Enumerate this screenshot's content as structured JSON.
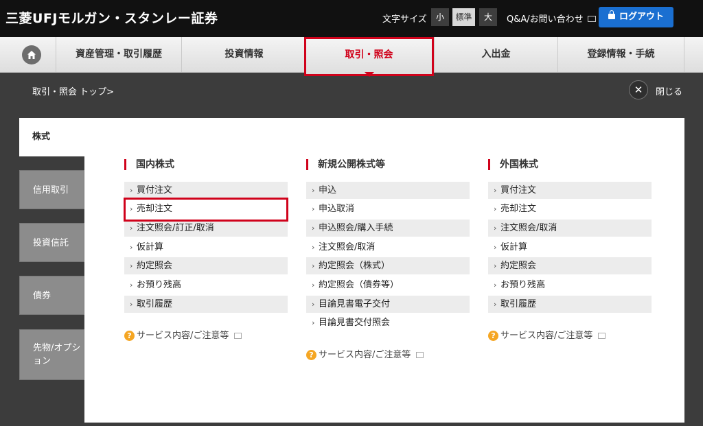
{
  "header": {
    "brand": "三菱UFJモルガン・スタンレー証券",
    "font_size_label": "文字サイズ",
    "font_small": "小",
    "font_standard": "標準",
    "font_large": "大",
    "qa_label": "Q&A/お問い合わせ",
    "logout_label": "ログアウト"
  },
  "nav": {
    "items": [
      {
        "label": "資産管理・取引履歴"
      },
      {
        "label": "投資情報"
      },
      {
        "label": "取引・照会"
      },
      {
        "label": "入出金"
      },
      {
        "label": "登録情報・手続"
      }
    ],
    "active": "取引・照会"
  },
  "breadcrumb": "取引・照会 トップ>",
  "close_label": "閉じる",
  "side_tabs": [
    {
      "label": "株式"
    },
    {
      "label": "信用取引"
    },
    {
      "label": "投資信託"
    },
    {
      "label": "債券"
    },
    {
      "label": "先物/オプション"
    }
  ],
  "columns": [
    {
      "title": "国内株式",
      "links": [
        "買付注文",
        "売却注文",
        "注文照会/訂正/取消",
        "仮計算",
        "約定照会",
        "お預り残高",
        "取引履歴"
      ],
      "service": "サービス内容/ご注意等"
    },
    {
      "title": "新規公開株式等",
      "links": [
        "申込",
        "申込取消",
        "申込照会/購入手続",
        "注文照会/取消",
        "約定照会（株式）",
        "約定照会（債券等）",
        "目論見書電子交付",
        "目論見書交付照会"
      ],
      "service": "サービス内容/ご注意等"
    },
    {
      "title": "外国株式",
      "links": [
        "買付注文",
        "売却注文",
        "注文照会/取消",
        "仮計算",
        "約定照会",
        "お預り残高",
        "取引履歴"
      ],
      "service": "サービス内容/ご注意等"
    }
  ],
  "colors": {
    "accent_red": "#d0021b",
    "logout_blue": "#1a6fd1",
    "help_orange": "#f5a623"
  }
}
